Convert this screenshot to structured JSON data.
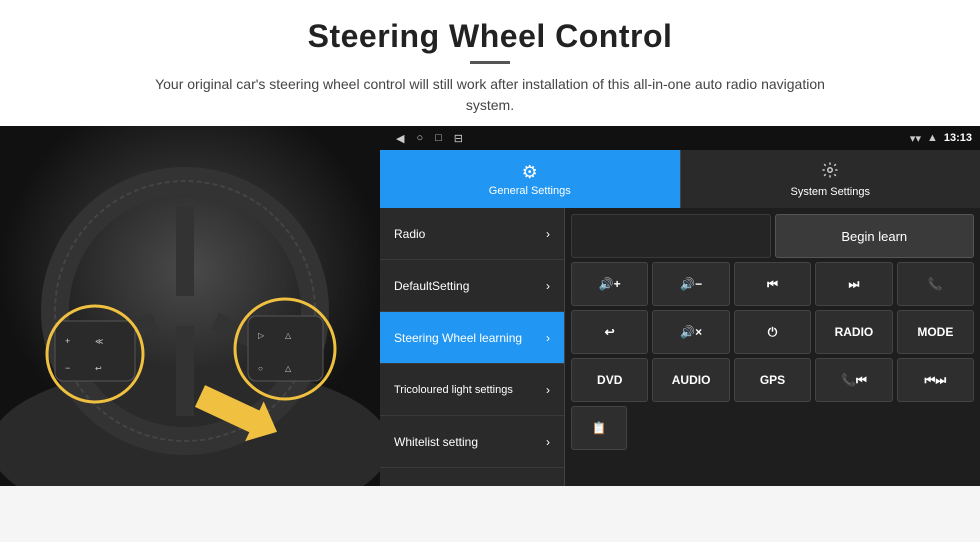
{
  "header": {
    "title": "Steering Wheel Control",
    "subtitle": "Your original car's steering wheel control will still work after installation of this all-in-one auto radio navigation system."
  },
  "statusBar": {
    "time": "13:13",
    "icons": [
      "◀",
      "○",
      "□",
      "⊟"
    ]
  },
  "tabs": [
    {
      "id": "general",
      "label": "General Settings",
      "icon": "⚙",
      "active": true
    },
    {
      "id": "system",
      "label": "System Settings",
      "icon": "🔧",
      "active": false
    }
  ],
  "menuItems": [
    {
      "id": "radio",
      "label": "Radio",
      "active": false
    },
    {
      "id": "default",
      "label": "DefaultSetting",
      "active": false
    },
    {
      "id": "steering",
      "label": "Steering Wheel learning",
      "active": true
    },
    {
      "id": "tricolour",
      "label": "Tricoloured light settings",
      "active": false
    },
    {
      "id": "whitelist",
      "label": "Whitelist setting",
      "active": false
    }
  ],
  "controlPanel": {
    "beginLearnLabel": "Begin learn",
    "row1": [
      "🔊+",
      "🔊−",
      "⏮",
      "⏭",
      "📞"
    ],
    "row2": [
      "↩",
      "🔊×",
      "⏻",
      "RADIO",
      "MODE"
    ],
    "row3": [
      "DVD",
      "AUDIO",
      "GPS",
      "📞⏮",
      "⏮⏭"
    ],
    "row4": [
      "📋"
    ]
  }
}
